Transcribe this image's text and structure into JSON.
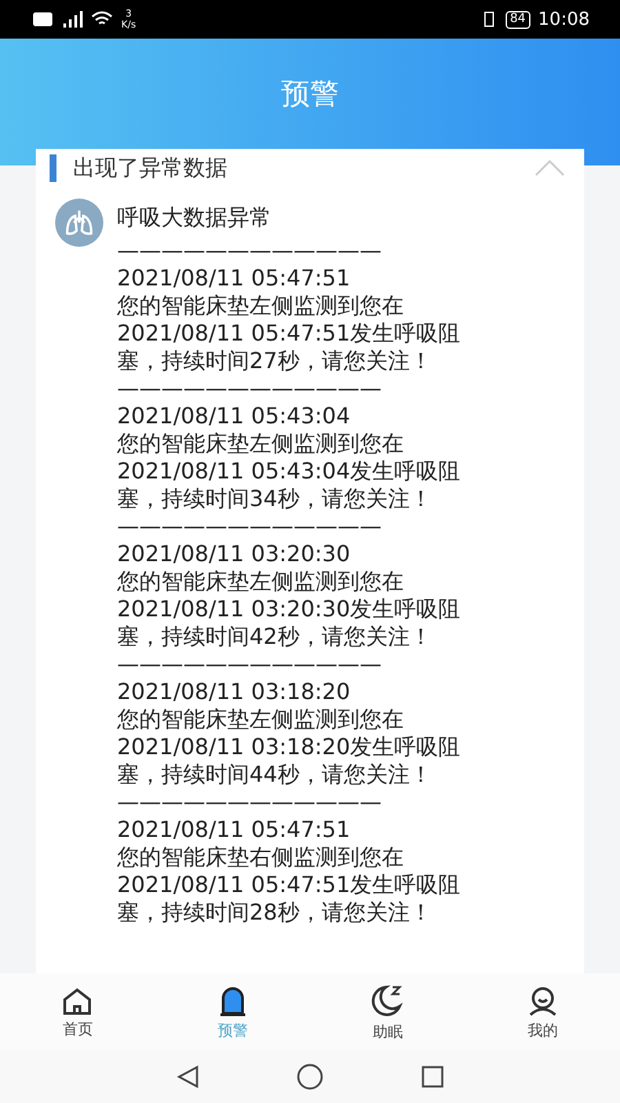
{
  "status_bar": {
    "speed_value": "3",
    "speed_unit": "K/s",
    "battery": "84",
    "time": "10:08"
  },
  "header": {
    "title": "预警"
  },
  "section": {
    "title": "出现了异常数据",
    "expanded": true
  },
  "message": {
    "title": "呼吸大数据异常",
    "entries": [
      {
        "separator": "————————————",
        "time": "2021/08/11 05:47:51",
        "lines": [
          "您的智能床垫左侧监测到您在",
          "2021/08/11 05:47:51发生呼吸阻",
          "塞，持续时间27秒，请您关注！"
        ]
      },
      {
        "separator": "————————————",
        "time": "2021/08/11 05:43:04",
        "lines": [
          "您的智能床垫左侧监测到您在",
          "2021/08/11 05:43:04发生呼吸阻",
          "塞，持续时间34秒，请您关注！"
        ]
      },
      {
        "separator": "————————————",
        "time": "2021/08/11 03:20:30",
        "lines": [
          "您的智能床垫左侧监测到您在",
          "2021/08/11 03:20:30发生呼吸阻",
          "塞，持续时间42秒，请您关注！"
        ]
      },
      {
        "separator": "————————————",
        "time": "2021/08/11 03:18:20",
        "lines": [
          "您的智能床垫左侧监测到您在",
          "2021/08/11 03:18:20发生呼吸阻",
          "塞，持续时间44秒，请您关注！"
        ]
      },
      {
        "separator": "————————————",
        "time": "2021/08/11 05:47:51",
        "lines": [
          "您的智能床垫右侧监测到您在",
          "2021/08/11 05:47:51发生呼吸阻",
          "塞，持续时间28秒，请您关注！"
        ]
      }
    ]
  },
  "tabs": [
    {
      "kind": "home",
      "label": "首页",
      "selected": false
    },
    {
      "kind": "alert",
      "label": "预警",
      "selected": true
    },
    {
      "kind": "sleep",
      "label": "助眠",
      "selected": false
    },
    {
      "kind": "profile",
      "label": "我的",
      "selected": false
    }
  ]
}
